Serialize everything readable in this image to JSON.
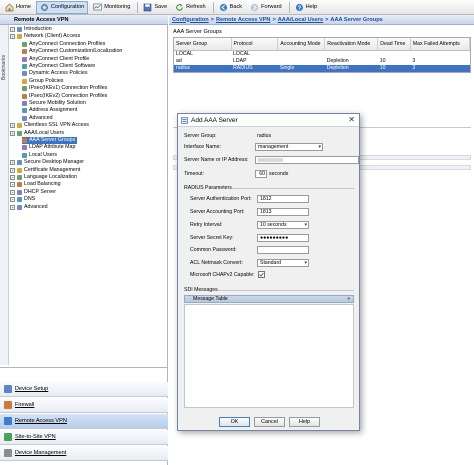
{
  "toolbar": {
    "items": [
      {
        "label": "Home",
        "icon": "home-icon"
      },
      {
        "label": "Configuration",
        "icon": "configuration-icon",
        "active": true
      },
      {
        "label": "Monitoring",
        "icon": "monitoring-icon"
      },
      {
        "label": "Save",
        "icon": "save-icon"
      },
      {
        "label": "Refresh",
        "icon": "refresh-icon"
      },
      {
        "label": "Back",
        "icon": "back-arrow-icon"
      },
      {
        "label": "Forward",
        "icon": "forward-arrow-icon"
      },
      {
        "label": "Help",
        "icon": "help-icon"
      }
    ]
  },
  "left_panel": {
    "title": "Remote Access VPN",
    "bookmarks_tab": "Bookmarks",
    "tree": [
      {
        "label": "Introduction",
        "depth": 0
      },
      {
        "label": "Network (Client) Access",
        "depth": 0
      },
      {
        "label": "AnyConnect Connection Profiles",
        "depth": 1
      },
      {
        "label": "AnyConnect Customization/Localization",
        "depth": 1
      },
      {
        "label": "AnyConnect Client Profile",
        "depth": 1
      },
      {
        "label": "AnyConnect Client Software",
        "depth": 1
      },
      {
        "label": "Dynamic Access Policies",
        "depth": 1
      },
      {
        "label": "Group Policies",
        "depth": 1
      },
      {
        "label": "IPsec(IKEv1) Connection Profiles",
        "depth": 1
      },
      {
        "label": "IPsec(IKEv2) Connection Profiles",
        "depth": 1
      },
      {
        "label": "Secure Mobility Solution",
        "depth": 1
      },
      {
        "label": "Address Assignment",
        "depth": 1
      },
      {
        "label": "Advanced",
        "depth": 1
      },
      {
        "label": "Clientless SSL VPN Access",
        "depth": 0
      },
      {
        "label": "AAA/Local Users",
        "depth": 0
      },
      {
        "label": "AAA Server Groups",
        "depth": 1,
        "selected": true
      },
      {
        "label": "LDAP Attribute Map",
        "depth": 1
      },
      {
        "label": "Local Users",
        "depth": 1
      },
      {
        "label": "Secure Desktop Manager",
        "depth": 0
      },
      {
        "label": "Certificate Management",
        "depth": 0
      },
      {
        "label": "Language Localization",
        "depth": 0
      },
      {
        "label": "Load Balancing",
        "depth": 0
      },
      {
        "label": "DHCP Server",
        "depth": 0
      },
      {
        "label": "DNS",
        "depth": 0
      },
      {
        "label": "Advanced",
        "depth": 0
      }
    ],
    "nav_buttons": [
      {
        "label": "Device Setup",
        "selected": false
      },
      {
        "label": "Firewall",
        "selected": false
      },
      {
        "label": "Remote Access VPN",
        "selected": true
      },
      {
        "label": "Site-to-Site VPN",
        "selected": false
      },
      {
        "label": "Device Management",
        "selected": false
      }
    ]
  },
  "breadcrumb": [
    "Configuration",
    "Remote Access VPN",
    "AAA/Local Users",
    "AAA Server Groups"
  ],
  "main": {
    "section_title": "AAA Server Groups",
    "table": {
      "columns": [
        "Server Group",
        "Protocol",
        "Accounting Mode",
        "Reactivation Mode",
        "Dead Time",
        "Max Failed Attempts"
      ],
      "rows": [
        [
          "LOCAL",
          "LOCAL",
          "",
          "",
          "",
          ""
        ],
        [
          "ad",
          "LDAP",
          "",
          "Depletion",
          "10",
          "3"
        ],
        [
          "radius",
          "RADIUS",
          "Single",
          "Depletion",
          "10",
          "3"
        ]
      ],
      "selected_row": 2
    }
  },
  "dialog": {
    "title": "Add AAA Server",
    "server_group_label": "Server Group:",
    "server_group_value": "radius",
    "interface_label": "Interface Name:",
    "interface_value": "management",
    "server_name_label": "Server Name or IP Address:",
    "server_name_value": "",
    "timeout_label": "Timeout:",
    "timeout_value": "60",
    "timeout_unit": "seconds",
    "radius_params_label": "RADIUS Parameters",
    "auth_port_label": "Server Authentication Port:",
    "auth_port_value": "1812",
    "acct_port_label": "Server Accounting Port:",
    "acct_port_value": "1813",
    "retry_label": "Retry Interval:",
    "retry_value": "10 seconds",
    "secret_label": "Server Secret Key:",
    "secret_value": "●●●●●●●●●",
    "common_pw_label": "Common Password:",
    "common_pw_value": "",
    "acl_label": "ACL Netmask Convert:",
    "acl_value": "Standard",
    "chap_label": "Microsoft CHAPv2 Capable:",
    "chap_checked": true,
    "sdi_label": "SDI Messages",
    "message_table_label": "Message Table",
    "ok_label": "OK",
    "cancel_label": "Cancel",
    "help_label": "Help"
  }
}
